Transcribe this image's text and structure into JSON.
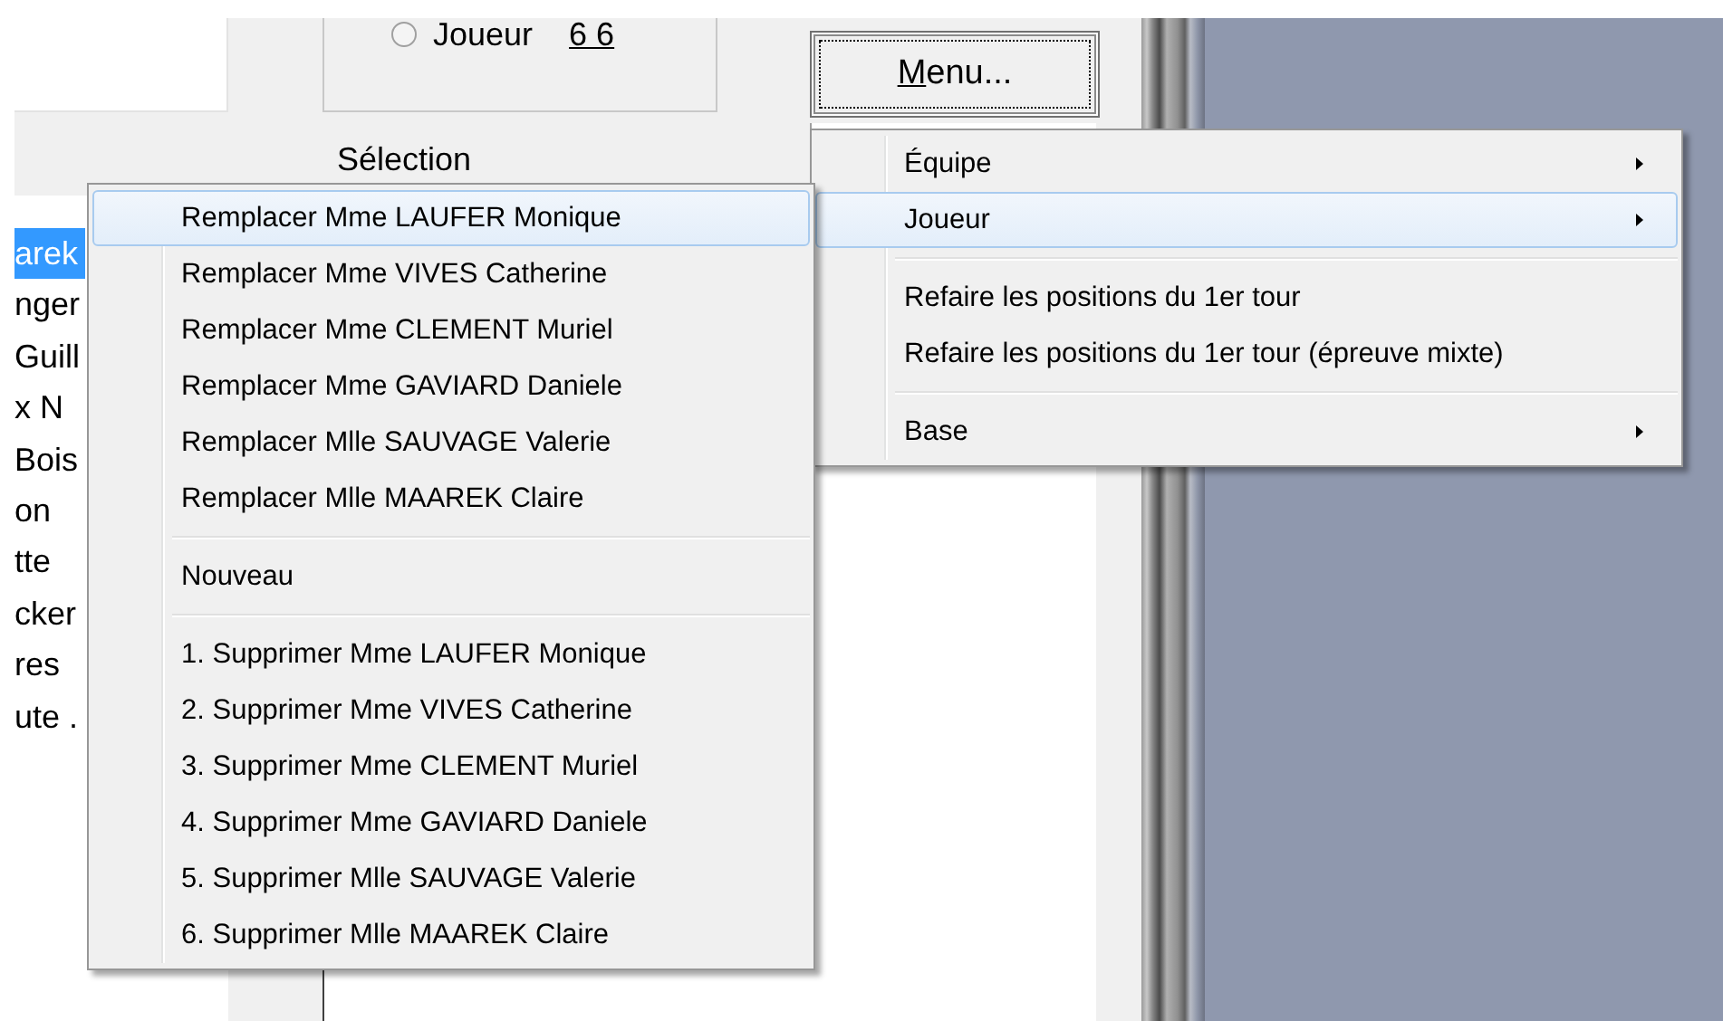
{
  "group_box": {
    "radio_selected": false,
    "radio_label": "Joueur",
    "value": "6 6"
  },
  "menu_button": {
    "label": "Menu...",
    "focused": true
  },
  "selection_label": "Sélection",
  "player_list": {
    "items": [
      {
        "text": "arek",
        "selected": true
      },
      {
        "text": "nger",
        "selected": false
      },
      {
        "text": "Guill",
        "selected": false
      },
      {
        "text": "x N",
        "selected": false
      },
      {
        "text": "Bois",
        "selected": false
      },
      {
        "text": "on",
        "selected": false
      },
      {
        "text": "tte",
        "selected": false
      },
      {
        "text": "cker",
        "selected": false
      },
      {
        "text": "res",
        "selected": false
      },
      {
        "text": "ute .",
        "selected": false
      }
    ]
  },
  "context_menu": {
    "items": [
      {
        "kind": "item",
        "label": "Équipe",
        "submenu": true,
        "selected": false
      },
      {
        "kind": "item",
        "label": "Joueur",
        "submenu": true,
        "selected": true
      },
      {
        "kind": "separator"
      },
      {
        "kind": "item",
        "label": "Refaire les positions du 1er tour",
        "submenu": false,
        "selected": false
      },
      {
        "kind": "item",
        "label": "Refaire les positions du 1er tour (épreuve mixte)",
        "submenu": false,
        "selected": false
      },
      {
        "kind": "separator"
      },
      {
        "kind": "item",
        "label": "Base",
        "submenu": true,
        "selected": false
      }
    ]
  },
  "submenu": {
    "items": [
      {
        "kind": "item",
        "label": "Remplacer Mme LAUFER Monique",
        "selected": true
      },
      {
        "kind": "item",
        "label": "Remplacer Mme VIVES Catherine",
        "selected": false
      },
      {
        "kind": "item",
        "label": "Remplacer Mme CLEMENT Muriel",
        "selected": false
      },
      {
        "kind": "item",
        "label": "Remplacer Mme GAVIARD Daniele",
        "selected": false
      },
      {
        "kind": "item",
        "label": "Remplacer Mlle SAUVAGE Valerie",
        "selected": false
      },
      {
        "kind": "item",
        "label": "Remplacer Mlle MAAREK Claire",
        "selected": false
      },
      {
        "kind": "separator"
      },
      {
        "kind": "item",
        "label": "Nouveau",
        "selected": false
      },
      {
        "kind": "separator"
      },
      {
        "kind": "item",
        "label": "1. Supprimer Mme LAUFER Monique",
        "selected": false
      },
      {
        "kind": "item",
        "label": "2. Supprimer Mme VIVES Catherine",
        "selected": false
      },
      {
        "kind": "item",
        "label": "3. Supprimer Mme CLEMENT Muriel",
        "selected": false
      },
      {
        "kind": "item",
        "label": "4. Supprimer Mme GAVIARD Daniele",
        "selected": false
      },
      {
        "kind": "item",
        "label": "5. Supprimer Mlle SAUVAGE Valerie",
        "selected": false
      },
      {
        "kind": "item",
        "label": "6. Supprimer Mlle MAAREK Claire",
        "selected": false
      }
    ]
  }
}
